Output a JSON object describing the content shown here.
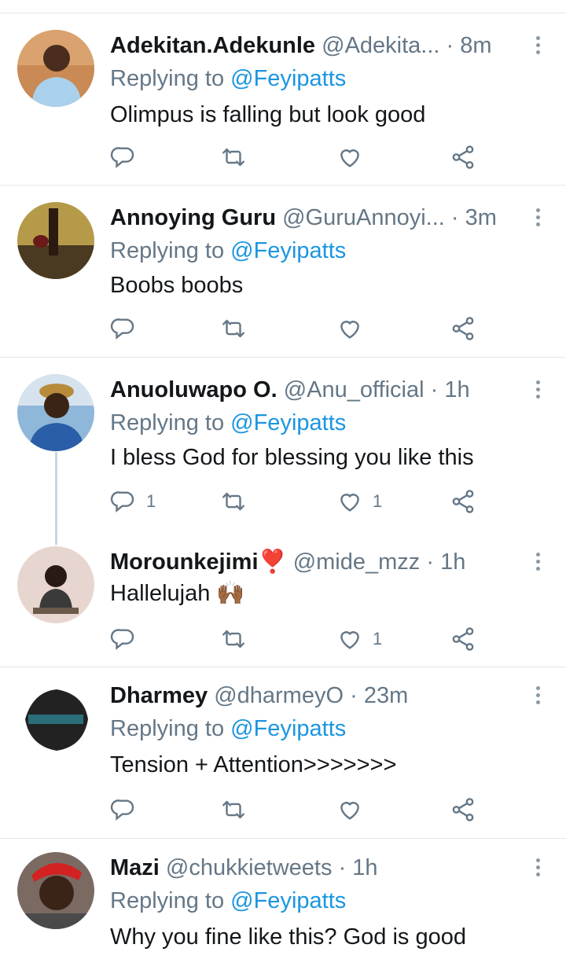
{
  "reply_prefix": "Replying to",
  "more_glyph": "⋮",
  "tweets": [
    {
      "name": "Adekitan.Adekunle",
      "handle": "@Adekita...",
      "time": "8m",
      "reply_to": "@Feyipatts",
      "text": "Olimpus is falling but look good",
      "reply_count": "",
      "like_count": ""
    },
    {
      "name": "Annoying Guru",
      "handle": "@GuruAnnoyi...",
      "time": "3m",
      "reply_to": "@Feyipatts",
      "text": "Boobs boobs",
      "reply_count": "",
      "like_count": ""
    },
    {
      "name": "Anuoluwapo O.",
      "handle": "@Anu_official",
      "time": "1h",
      "reply_to": "@Feyipatts",
      "text": "I bless God for blessing you like this",
      "reply_count": "1",
      "like_count": "1"
    },
    {
      "name": "Morounkejimi❣️",
      "handle": "@mide_mzz",
      "time": "1h",
      "reply_to": "",
      "text": "Hallelujah 🙌🏾",
      "reply_count": "",
      "like_count": "1"
    },
    {
      "name": "Dharmey",
      "handle": "@dharmeyO",
      "time": "23m",
      "reply_to": "@Feyipatts",
      "text": "Tension + Attention>>>>>>>",
      "reply_count": "",
      "like_count": ""
    },
    {
      "name": "Mazi",
      "handle": "@chukkietweets",
      "time": "1h",
      "reply_to": "@Feyipatts",
      "text": "Why you fine like this? God is good",
      "reply_count": "",
      "like_count": ""
    }
  ],
  "icons": {
    "reply": "reply-icon",
    "retweet": "retweet-icon",
    "like": "heart-icon",
    "share": "share-icon",
    "more": "more-vertical-icon"
  },
  "colors": {
    "mention": "#1b95e0",
    "secondary_text": "#657786",
    "divider": "#e1e8ed",
    "icon": "#657786"
  }
}
